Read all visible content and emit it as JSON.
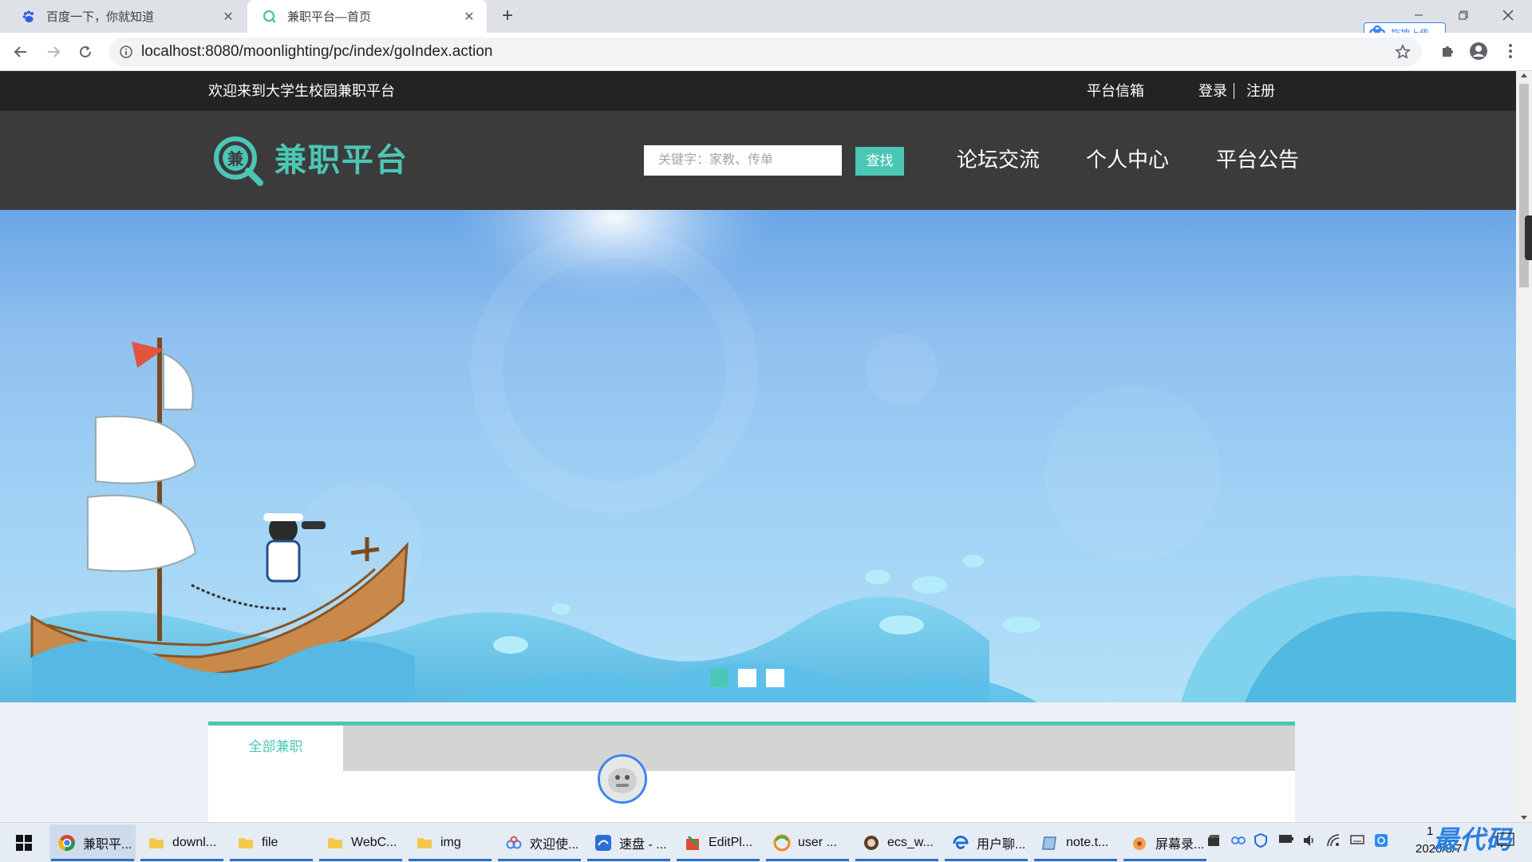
{
  "browser": {
    "tabs": [
      {
        "title": "百度一下，你就知道",
        "favicon": "baidu-paw-icon"
      },
      {
        "title": "兼职平台—首页",
        "favicon": "search-logo-icon"
      }
    ],
    "url": "localhost:8080/moonlighting/pc/index/goIndex.action",
    "extension_label": "拖拽上传"
  },
  "site": {
    "topbar": {
      "welcome": "欢迎来到大学生校园兼职平台",
      "mailbox": "平台信箱",
      "login": "登录",
      "register": "注册"
    },
    "logo": {
      "glyph": "兼",
      "text": "兼职平台"
    },
    "search": {
      "placeholder": "关键字：家教、传单",
      "button": "查找"
    },
    "nav": [
      "论坛交流",
      "个人中心",
      "平台公告"
    ],
    "banner": {
      "slide_count": 3,
      "active_slide": 1
    },
    "content": {
      "tab_label": "全部兼职"
    }
  },
  "taskbar": {
    "items": [
      {
        "label": "兼职平...",
        "icon": "chrome-icon"
      },
      {
        "label": "downl...",
        "icon": "folder-icon"
      },
      {
        "label": "file",
        "icon": "folder-icon"
      },
      {
        "label": "WebC...",
        "icon": "folder-icon"
      },
      {
        "label": "img",
        "icon": "folder-icon"
      },
      {
        "label": "欢迎使...",
        "icon": "cloud-icon"
      },
      {
        "label": "速盘 - ...",
        "icon": "speedpan-icon"
      },
      {
        "label": "EditPl...",
        "icon": "editplus-icon"
      },
      {
        "label": "user ...",
        "icon": "browser-ring-icon"
      },
      {
        "label": "ecs_w...",
        "icon": "app-icon"
      },
      {
        "label": "用户聊...",
        "icon": "edge-icon"
      },
      {
        "label": "note.t...",
        "icon": "notepad-icon"
      },
      {
        "label": "屏幕录...",
        "icon": "recorder-icon"
      }
    ],
    "clock_date": "2020/8/7",
    "clock_time": "1",
    "watermark": "最代码"
  },
  "colors": {
    "accent": "#4cc6b5",
    "topbar": "#232323",
    "nav": "#3b3b3b"
  }
}
